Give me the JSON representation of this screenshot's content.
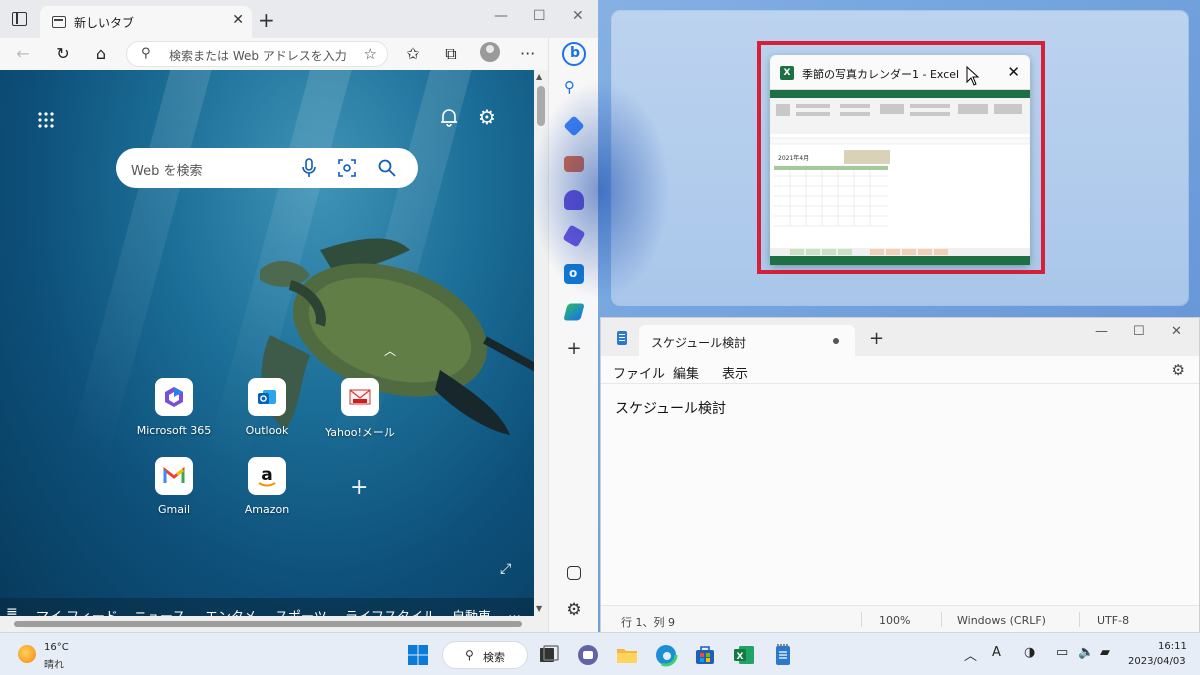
{
  "edge": {
    "tab_title": "新しいタブ",
    "address_placeholder": "検索または Web アドレスを入力",
    "search_placeholder": "Web を検索",
    "quick_links": [
      {
        "label": "Microsoft 365",
        "icon": "microsoft365-icon"
      },
      {
        "label": "Outlook",
        "icon": "outlook-icon"
      },
      {
        "label": "Yahoo!メール",
        "icon": "yahoo-mail-icon"
      },
      {
        "label": "Gmail",
        "icon": "gmail-icon"
      },
      {
        "label": "Amazon",
        "icon": "amazon-icon"
      }
    ],
    "feed_items": [
      "マイ フィード",
      "ニュース",
      "エンタメ",
      "スポーツ",
      "ライフスタイル",
      "自動車",
      "…"
    ]
  },
  "snap_preview": {
    "title": "季節の写真カレンダー1 - Excel",
    "sheet_heading": "2021年4月"
  },
  "notepad": {
    "tab_title": "スケジュール検討",
    "menu": [
      "ファイル",
      "編集",
      "表示"
    ],
    "content": "スケジュール検討",
    "status": {
      "position": "行 1、列 9",
      "zoom": "100%",
      "line_ending": "Windows (CRLF)",
      "encoding": "UTF-8"
    }
  },
  "taskbar": {
    "weather_temp": "16°C",
    "weather_cond": "晴れ",
    "search_label": "検索",
    "ime": "A",
    "time": "16:11",
    "date": "2023/04/03"
  },
  "colors": {
    "highlight_border": "#d6203a",
    "excel_green": "#1d7044",
    "edge_blue": "#0f5db6"
  }
}
